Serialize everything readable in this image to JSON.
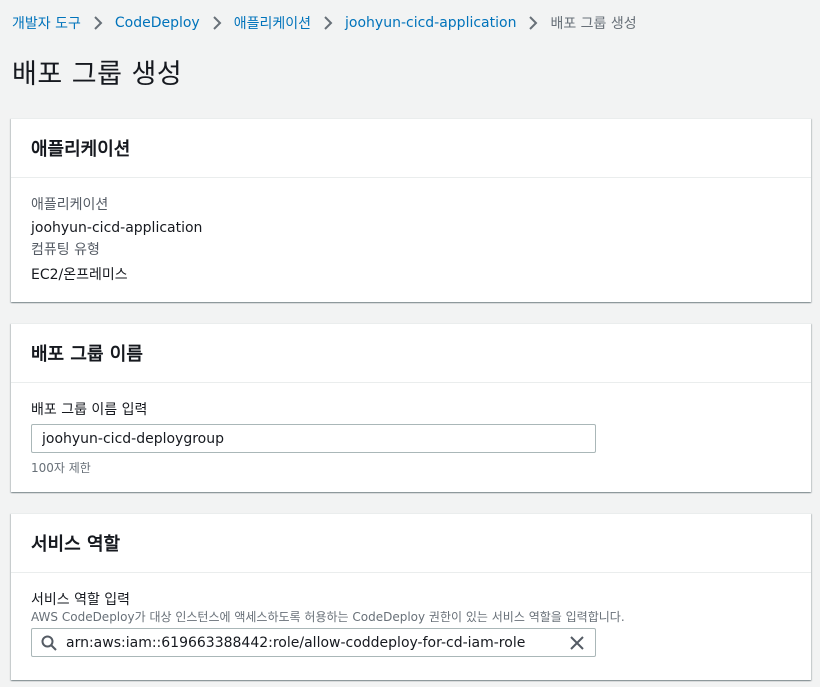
{
  "breadcrumb": {
    "items": [
      "개발자 도구",
      "CodeDeploy",
      "애플리케이션",
      "joohyun-cicd-application"
    ],
    "current": "배포 그룹 생성"
  },
  "page_title": "배포 그룹 생성",
  "application_panel": {
    "title": "애플리케이션",
    "app_label": "애플리케이션",
    "app_value": "joohyun-cicd-application",
    "compute_label": "컴퓨팅 유형",
    "compute_value": "EC2/온프레미스"
  },
  "group_name_panel": {
    "title": "배포 그룹 이름",
    "input_label": "배포 그룹 이름 입력",
    "input_value": "joohyun-cicd-deploygroup",
    "limit_hint": "100자 제한"
  },
  "service_role_panel": {
    "title": "서비스 역할",
    "input_label": "서비스 역할 입력",
    "description": "AWS CodeDeploy가 대상 인스턴스에 액세스하도록 허용하는 CodeDeploy 권한이 있는 서비스 역할을 입력합니다.",
    "input_value": "arn:aws:iam::619663388442:role/allow-coddeploy-for-cd-iam-role"
  },
  "colors": {
    "link": "#0073bb",
    "background": "#f2f3f3",
    "border": "#aab7b8"
  }
}
